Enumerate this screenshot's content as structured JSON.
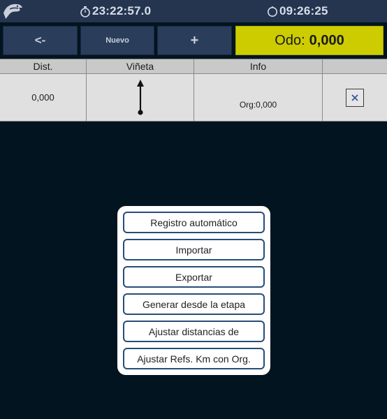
{
  "statusbar": {
    "logo_icon": "eagle-logo-icon",
    "clock_left": "23:22:57.0",
    "clock_right": "09:26:25",
    "clock_icon": "stopwatch-icon"
  },
  "toolbar": {
    "back_label": "<-",
    "new_label": "Nuevo",
    "plus_label": "+",
    "odo_label": "Odo:",
    "odo_value": "0,000"
  },
  "table": {
    "headers": [
      "Dist.",
      "Viñeta",
      "Info",
      ""
    ],
    "rows": [
      {
        "dist": "0,000",
        "vineta_icon": "arrow-up-icon",
        "info": "Org:0,000",
        "action_icon": "close-icon"
      }
    ]
  },
  "dialog": {
    "items": [
      "Registro automático",
      "Importar",
      "Exportar",
      "Generar desde la etapa",
      "Ajustar distancias de",
      "Ajustar Refs. Km con Org."
    ]
  },
  "colors": {
    "background": "#021420",
    "statusbar": "#253550",
    "button": "#2a3e5c",
    "odo": "#cccc00",
    "dialog_border": "#264d79"
  }
}
